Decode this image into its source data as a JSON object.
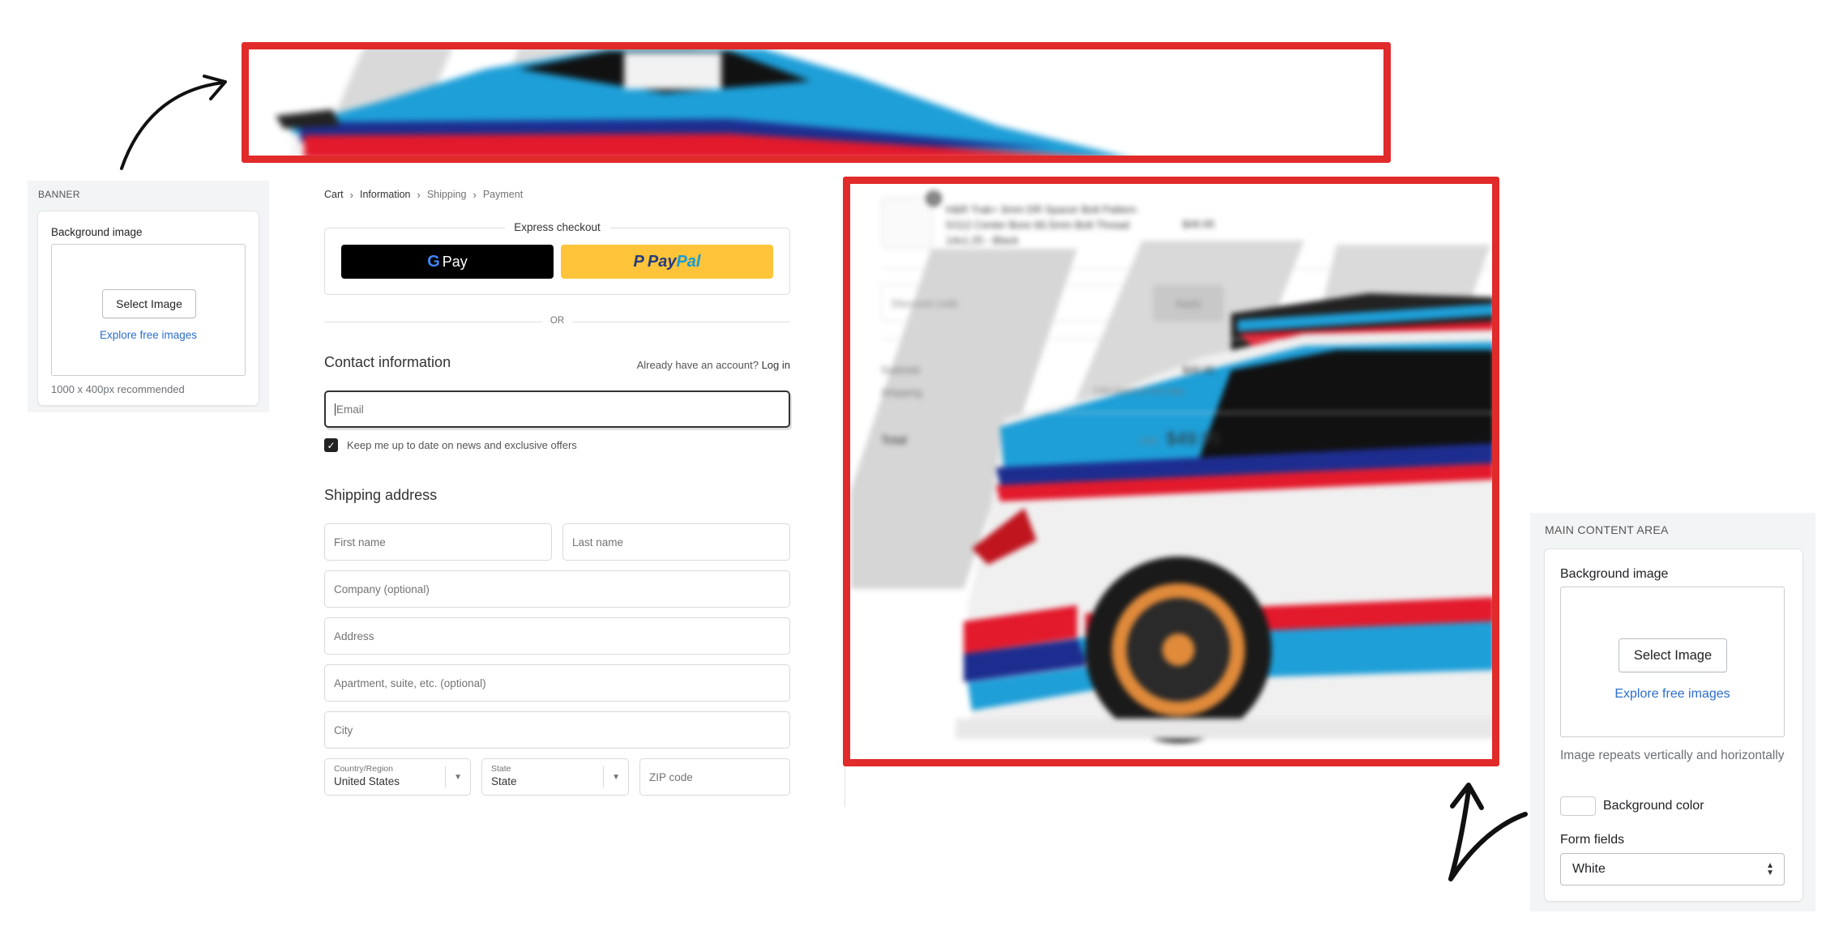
{
  "colors": {
    "annotation_red": "#e12a2a",
    "link_blue": "#2c6ecb",
    "paypal_yellow": "#ffc439",
    "car_blue": "#1e9fd8",
    "car_red": "#e3192c",
    "car_navy": "#1d2d8f"
  },
  "banner_panel": {
    "heading": "BANNER",
    "field_label": "Background image",
    "select_button": "Select Image",
    "explore_link": "Explore free images",
    "helper": "1000 x 400px recommended"
  },
  "main_panel": {
    "heading": "MAIN CONTENT AREA",
    "field_label": "Background image",
    "select_button": "Select Image",
    "explore_link": "Explore free images",
    "helper": "Image repeats vertically and horizontally",
    "color_label": "Background color",
    "form_fields_label": "Form fields",
    "form_fields_value": "White"
  },
  "checkout": {
    "breadcrumb": [
      "Cart",
      "Information",
      "Shipping",
      "Payment"
    ],
    "express_title": "Express checkout",
    "gpay_label": "Pay",
    "paypal_label_1": "Pay",
    "paypal_label_2": "Pal",
    "or_label": "OR",
    "contact_title": "Contact information",
    "account_prompt": "Already have an account?",
    "login_link": "Log in",
    "email_placeholder": "Email",
    "newsletter_label": "Keep me up to date on news and exclusive offers",
    "newsletter_checked": true,
    "shipping_title": "Shipping address",
    "first_name": "First name",
    "last_name": "Last name",
    "company": "Company (optional)",
    "address": "Address",
    "apartment": "Apartment, suite, etc. (optional)",
    "city": "City",
    "country_label": "Country/Region",
    "country_value": "United States",
    "state_label": "State",
    "state_value": "State",
    "zip": "ZIP code"
  },
  "summary": {
    "item_quantity": "1",
    "item_title_1": "H&R Trak+ 3mm DR Spacer Bolt Pattern",
    "item_title_2": "5/112 Center Bore 66.5mm Bolt Thread",
    "item_title_3": "14x1.25 - Black",
    "item_price": "$49.95",
    "discount_placeholder": "Discount code",
    "apply_label": "Apply",
    "subtotal_label": "Subtotal",
    "subtotal_value": "$49.95",
    "shipping_label": "Shipping",
    "shipping_value": "Calculated at next step",
    "total_label": "Total",
    "total_currency": "USD",
    "total_value": "$49.95"
  }
}
